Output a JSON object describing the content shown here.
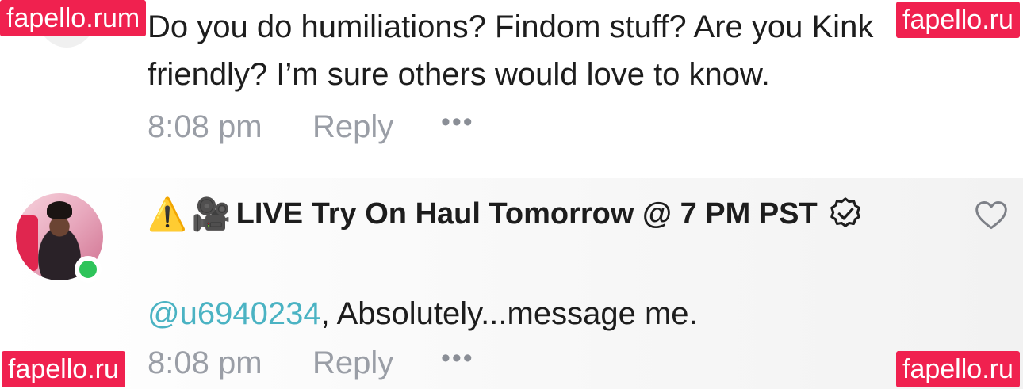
{
  "watermarks": {
    "top_left": "fapello.rum",
    "top_right": "fapello.ru",
    "bottom_left": "fapello.ru",
    "bottom_right": "fapello.ru"
  },
  "comments": [
    {
      "text": "Do you do humiliations? Findom stuff? Are you Kink friendly? I’m sure others would love to know.",
      "time": "8:08 pm",
      "reply_label": "Reply",
      "more_label": "•••",
      "online": true
    },
    {
      "username_prefix_icons": [
        "⚠️",
        "🎥"
      ],
      "username": "LIVE Try On Haul Tomorrow @ 7 PM PST",
      "verified": true,
      "mention": "@u6940234",
      "text": ", Absolutely...message me.",
      "time": "8:08 pm",
      "reply_label": "Reply",
      "more_label": "•••",
      "online": true,
      "like_icon": "heart-outline-icon"
    }
  ],
  "colors": {
    "online": "#2ec45a",
    "mention": "#4bb3c3",
    "meta": "#9a9ea6",
    "watermark": "#f0214f"
  }
}
